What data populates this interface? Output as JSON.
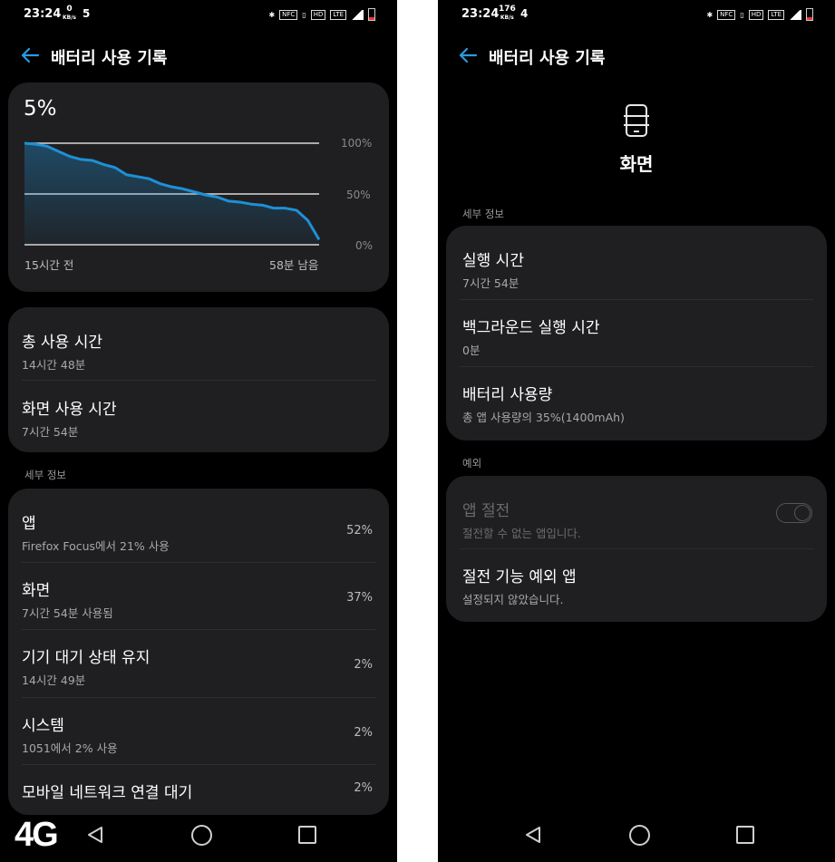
{
  "left": {
    "status": {
      "time": "23:24",
      "speed_value": "0",
      "speed_unit": "KB/s",
      "notif_count": "5",
      "volte": "HD",
      "lte": "LTE",
      "nfc": "NFC"
    },
    "appbar": {
      "title": "배터리 사용 기록"
    },
    "chart_data": {
      "type": "area",
      "title": "5%",
      "x_start_label": "15시간 전",
      "x_end_label": "58분 남음",
      "y_ticks": [
        "100%",
        "50%",
        "0%"
      ],
      "ylim": [
        0,
        100
      ],
      "x": [
        0,
        1,
        2,
        3,
        4,
        5,
        6,
        7,
        8,
        9,
        10,
        11,
        12,
        13,
        14,
        15,
        16,
        17,
        18,
        19,
        20,
        21,
        22,
        23,
        24,
        25,
        26
      ],
      "values": [
        100,
        99,
        97,
        92,
        87,
        84,
        83,
        79,
        76,
        69,
        67,
        65,
        60,
        57,
        55,
        52,
        49,
        47,
        43,
        42,
        40,
        39,
        36,
        36,
        34,
        24,
        5
      ],
      "grid": true,
      "line_color": "#1e90d6"
    },
    "usage": {
      "total": {
        "title": "총 사용 시간",
        "sub": "14시간 48분"
      },
      "screen": {
        "title": "화면 사용 시간",
        "sub": "7시간 54분"
      }
    },
    "details_label": "세부 정보",
    "details": [
      {
        "title": "앱",
        "sub": "Firefox Focus에서 21% 사용",
        "pct": "52%"
      },
      {
        "title": "화면",
        "sub": "7시간 54분 사용됨",
        "pct": "37%"
      },
      {
        "title": "기기 대기 상태 유지",
        "sub": "14시간 49분",
        "pct": "2%"
      },
      {
        "title": "시스템",
        "sub": "1051에서 2% 사용",
        "pct": "2%"
      },
      {
        "title": "모바일 네트워크 연결 대기",
        "sub": "",
        "pct": "2%"
      }
    ],
    "network_badge": "4G"
  },
  "right": {
    "status": {
      "time": "23:24",
      "speed_value": "176",
      "speed_unit": "KB/s",
      "notif_count": "4",
      "volte": "HD",
      "lte": "LTE",
      "nfc": "NFC"
    },
    "appbar": {
      "title": "배터리 사용 기록"
    },
    "header": {
      "icon": "phone-screen-icon",
      "title": "화면"
    },
    "details_label": "세부 정보",
    "details": [
      {
        "title": "실행 시간",
        "sub": "7시간 54분"
      },
      {
        "title": "백그라운드 실행 시간",
        "sub": "0분"
      },
      {
        "title": "배터리 사용량",
        "sub": "총 앱 사용량의 35%(1400mAh)"
      }
    ],
    "exceptions_label": "예외",
    "exceptions": [
      {
        "title": "앱 절전",
        "sub": "절전할 수 없는 앱입니다.",
        "enabled": false
      },
      {
        "title": "절전 기능 예외 앱",
        "sub": "설정되지 않았습니다."
      }
    ]
  }
}
